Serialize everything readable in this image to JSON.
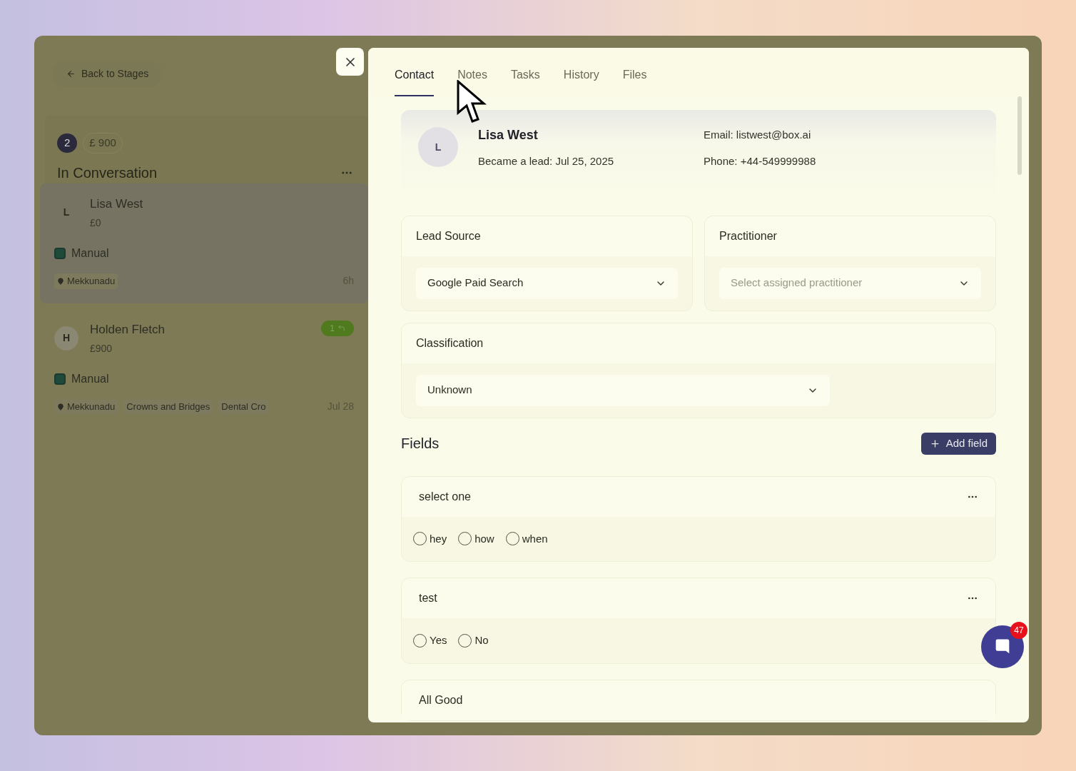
{
  "back_button": "Back to Stages",
  "stage": {
    "count": "2",
    "amount": "£ 900",
    "title": "In Conversation"
  },
  "leads": [
    {
      "initial": "L",
      "name": "Lisa West",
      "value": "£0",
      "source": "Manual",
      "tags": [
        "Mekkunadu"
      ],
      "time": "6h",
      "selected": true
    },
    {
      "initial": "H",
      "name": "Holden Fletch",
      "value": "£900",
      "source": "Manual",
      "tags": [
        "Mekkunadu",
        "Crowns and Bridges",
        "Dental Cro"
      ],
      "time": "Jul 28",
      "selected": false,
      "badge": "1"
    }
  ],
  "tabs": [
    {
      "label": "Contact",
      "selected": true
    },
    {
      "label": "Notes",
      "selected": false
    },
    {
      "label": "Tasks",
      "selected": false
    },
    {
      "label": "History",
      "selected": false
    },
    {
      "label": "Files",
      "selected": false
    }
  ],
  "contact": {
    "initial": "L",
    "name": "Lisa West",
    "became_lead": "Became a lead: Jul 25, 2025",
    "email": "Email: listwest@box.ai",
    "phone": "Phone: +44-549999988"
  },
  "selects": [
    {
      "label": "Lead Source",
      "value": "Google Paid Search"
    },
    {
      "label": "Practitioner",
      "placeholder": "Select assigned practitioner"
    },
    {
      "label": "Classification",
      "value": "Unknown"
    }
  ],
  "fields_title": "Fields",
  "add_field": "Add field",
  "fields": [
    {
      "label": "select one",
      "options": [
        {
          "label": "hey",
          "selected": false
        },
        {
          "label": "how",
          "selected": false
        },
        {
          "label": "when",
          "selected": false
        }
      ]
    },
    {
      "label": "test",
      "options": [
        {
          "label": "Yes",
          "selected": false
        },
        {
          "label": "No",
          "selected": false
        }
      ]
    },
    {
      "label": "All Good"
    }
  ],
  "chat": {
    "badge": "47"
  }
}
